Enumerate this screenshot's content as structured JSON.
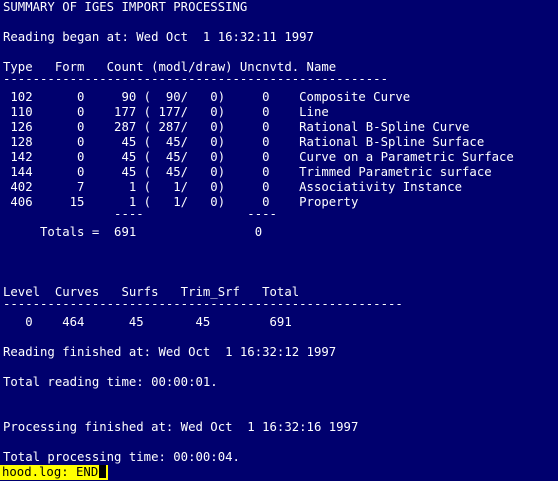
{
  "report": {
    "title": "SUMMARY OF IGES IMPORT PROCESSING",
    "reading_began": "Reading began at: Wed Oct  1 16:32:11 1997",
    "entity_table": {
      "header": "Type   Form   Count (modl/draw) Uncnvtd. Name",
      "separator": "----------------------------------------------------",
      "rows": [
        " 102      0     90 (  90/   0)     0    Composite Curve",
        " 110      0    177 ( 177/   0)     0    Line",
        " 126      0    287 ( 287/   0)     0    Rational B-Spline Curve",
        " 128      0     45 (  45/   0)     0    Rational B-Spline Surface",
        " 142      0     45 (  45/   0)     0    Curve on a Parametric Surface",
        " 144      0     45 (  45/   0)     0    Trimmed Parametric surface",
        " 402      7      1 (   1/   0)     0    Associativity Instance",
        " 406     15      1 (   1/   0)     0    Property"
      ],
      "totals_rule": "               ----              ----",
      "totals": "     Totals =  691                0"
    },
    "level_table": {
      "header": "Level  Curves   Surfs   Trim_Srf   Total",
      "separator": "------------------------------------------------------",
      "row": "   0    464      45       45        691"
    },
    "reading_finished": "Reading finished at: Wed Oct  1 16:32:12 1997",
    "total_reading_time": "Total reading time: 00:00:01.",
    "processing_finished": "Processing finished at: Wed Oct  1 16:32:16 1997",
    "total_processing_time": "Total processing time: 00:00:04."
  },
  "statusbar": {
    "text": "hood.log: END"
  },
  "colors": {
    "background": "#00006e",
    "text": "#ffffff",
    "statusbar_bg": "#ffff00",
    "statusbar_text": "#000000"
  }
}
